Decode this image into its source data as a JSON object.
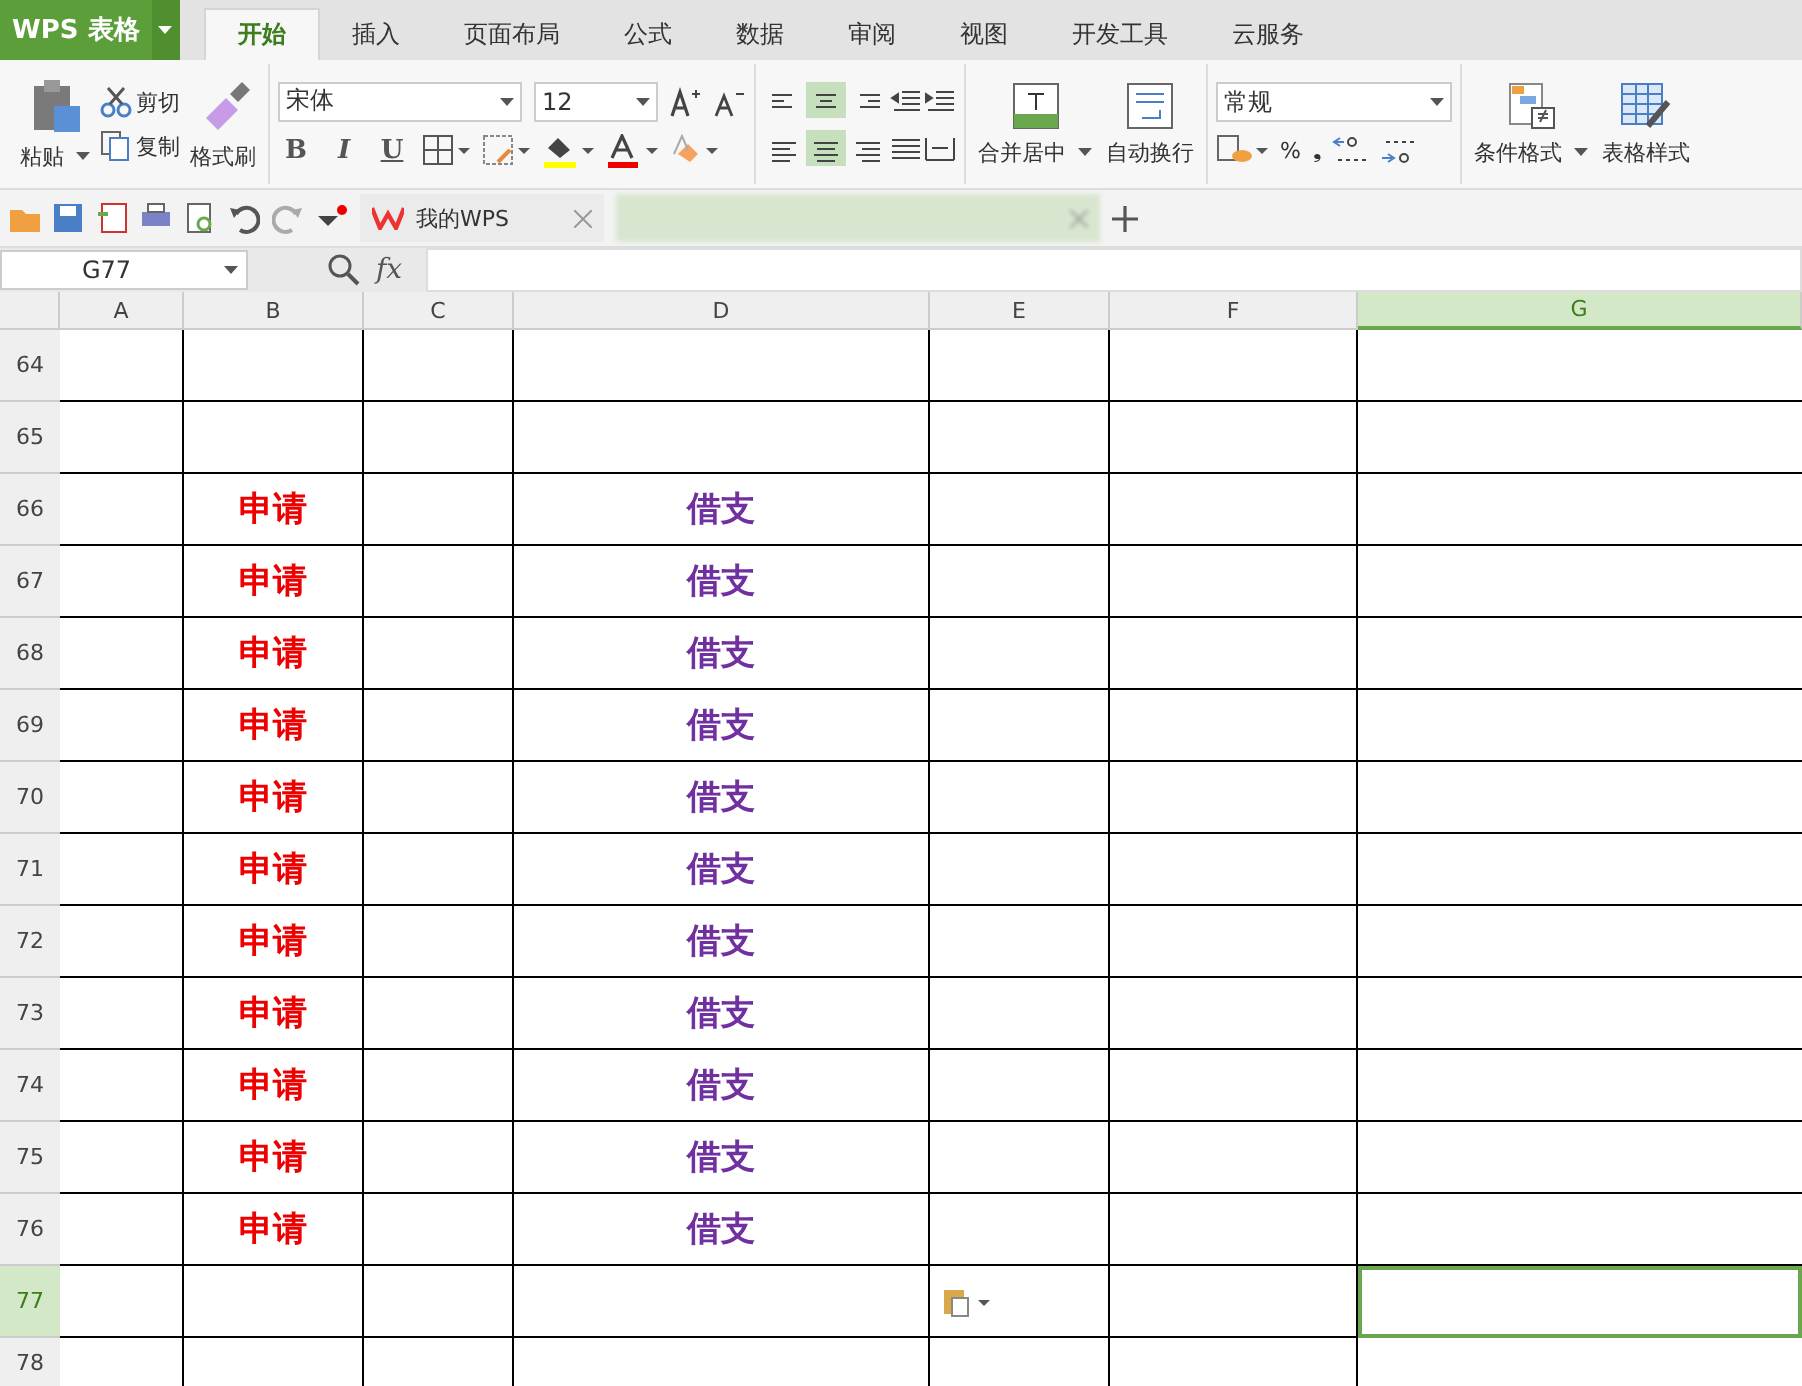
{
  "app": {
    "logo": "WPS 表格"
  },
  "tabs": [
    {
      "label": "开始",
      "selected": true
    },
    {
      "label": "插入",
      "selected": false
    },
    {
      "label": "页面布局",
      "selected": false
    },
    {
      "label": "公式",
      "selected": false
    },
    {
      "label": "数据",
      "selected": false
    },
    {
      "label": "审阅",
      "selected": false
    },
    {
      "label": "视图",
      "selected": false
    },
    {
      "label": "开发工具",
      "selected": false
    },
    {
      "label": "云服务",
      "selected": false
    }
  ],
  "ribbon": {
    "paste": "粘贴",
    "cut": "剪切",
    "copy": "复制",
    "format_painter": "格式刷",
    "font_name": "宋体",
    "font_size": "12",
    "styles": [
      "B",
      "I",
      "U"
    ],
    "align_vertical": [
      {
        "selected": false
      },
      {
        "selected": true
      },
      {
        "selected": false
      }
    ],
    "align_horizontal": [
      {
        "selected": false
      },
      {
        "selected": true
      },
      {
        "selected": false
      }
    ],
    "merge": "合并居中",
    "wrap": "自动换行",
    "number_format": "常规",
    "percent": "%",
    "comma": "❟",
    "conditional": "条件格式",
    "table_style": "表格样式"
  },
  "doc_tabs": [
    {
      "title": "我的WPS",
      "selected": false
    },
    {
      "selected": true
    }
  ],
  "formula_bar": {
    "name_box": "G77",
    "fx": "fx"
  },
  "sheet": {
    "columns": [
      {
        "label": "A",
        "selected": false
      },
      {
        "label": "B",
        "selected": false
      },
      {
        "label": "C",
        "selected": false
      },
      {
        "label": "D",
        "selected": false
      },
      {
        "label": "E",
        "selected": false
      },
      {
        "label": "F",
        "selected": false
      },
      {
        "label": "G",
        "selected": true
      }
    ],
    "rows": [
      {
        "number": "64",
        "selected": false
      },
      {
        "number": "65",
        "selected": false
      },
      {
        "number": "66",
        "selected": false,
        "b": "申请",
        "d": "借支"
      },
      {
        "number": "67",
        "selected": false,
        "b": "申请",
        "d": "借支"
      },
      {
        "number": "68",
        "selected": false,
        "b": "申请",
        "d": "借支"
      },
      {
        "number": "69",
        "selected": false,
        "b": "申请",
        "d": "借支"
      },
      {
        "number": "70",
        "selected": false,
        "b": "申请",
        "d": "借支"
      },
      {
        "number": "71",
        "selected": false,
        "b": "申请",
        "d": "借支"
      },
      {
        "number": "72",
        "selected": false,
        "b": "申请",
        "d": "借支"
      },
      {
        "number": "73",
        "selected": false,
        "b": "申请",
        "d": "借支"
      },
      {
        "number": "74",
        "selected": false,
        "b": "申请",
        "d": "借支"
      },
      {
        "number": "75",
        "selected": false,
        "b": "申请",
        "d": "借支"
      },
      {
        "number": "76",
        "selected": false,
        "b": "申请",
        "d": "借支"
      },
      {
        "number": "77",
        "selected": true,
        "paste_options": true
      },
      {
        "number": "78",
        "selected": false
      }
    ]
  }
}
